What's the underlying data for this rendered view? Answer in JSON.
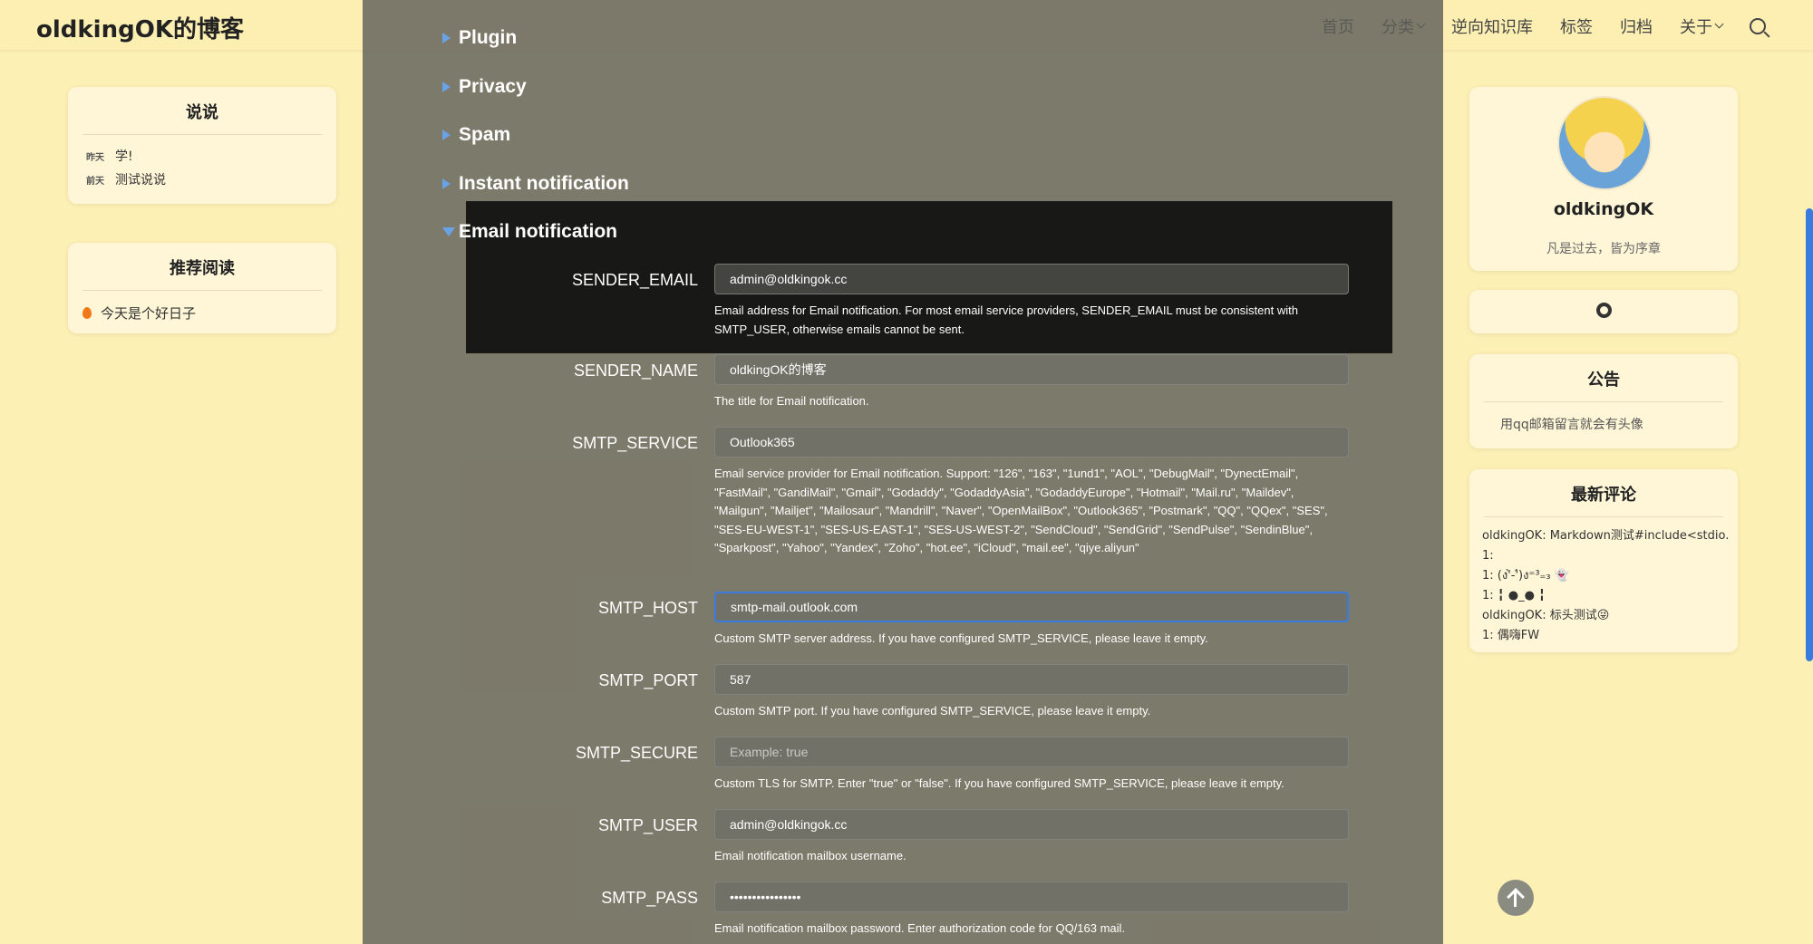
{
  "header": {
    "title": "oldkingOK的博客",
    "nav": [
      "首页",
      "分类",
      "逆向知识库",
      "标签",
      "归档",
      "关于"
    ]
  },
  "left": {
    "shuoshuo": {
      "title": "说说",
      "items": [
        {
          "date": "昨天",
          "text": "学!"
        },
        {
          "date": "前天",
          "text": "测试说说"
        }
      ]
    },
    "recommend": {
      "title": "推荐阅读",
      "items": [
        "今天是个好日子"
      ]
    }
  },
  "right": {
    "profile": {
      "name": "oldkingOK",
      "motto": "凡是过去，皆为序章"
    },
    "notice": {
      "title": "公告",
      "text": "用qq邮箱留言就会有头像"
    },
    "comments": {
      "title": "最新评论",
      "lines": [
        "oldkingOK: Markdown测试#include<stdio.",
        "1:",
        "1: (ง'̀-'́)ง⁼³₌₃ 👻",
        "1: ╏ ●_● ╏",
        "oldkingOK: 标头测试😜",
        "1: 偶嗨FW"
      ]
    }
  },
  "panel": {
    "sections": [
      {
        "label": "Plugin",
        "expanded": false
      },
      {
        "label": "Privacy",
        "expanded": false
      },
      {
        "label": "Spam",
        "expanded": false
      },
      {
        "label": "Instant notification",
        "expanded": false
      },
      {
        "label": "Email notification",
        "expanded": true
      }
    ],
    "fields": [
      {
        "label": "SENDER_EMAIL",
        "value": "admin@oldkingok.cc",
        "placeholder": "",
        "help": "Email address for Email notification. For most email service providers, SENDER_EMAIL must be consistent with SMTP_USER, otherwise emails cannot be sent."
      },
      {
        "label": "SENDER_NAME",
        "value": "oldkingOK的博客",
        "placeholder": "",
        "help": "The title for Email notification."
      },
      {
        "label": "SMTP_SERVICE",
        "value": "Outlook365",
        "placeholder": "",
        "help": "Email service provider for Email notification. Support: \"126\", \"163\", \"1und1\", \"AOL\", \"DebugMail\", \"DynectEmail\", \"FastMail\", \"GandiMail\", \"Gmail\", \"Godaddy\", \"GodaddyAsia\", \"GodaddyEurope\", \"Hotmail\", \"Mail.ru\", \"Maildev\", \"Mailgun\", \"Mailjet\", \"Mailosaur\", \"Mandrill\", \"Naver\", \"OpenMailBox\", \"Outlook365\", \"Postmark\", \"QQ\", \"QQex\", \"SES\", \"SES-EU-WEST-1\", \"SES-US-EAST-1\", \"SES-US-WEST-2\", \"SendCloud\", \"SendGrid\", \"SendPulse\", \"SendinBlue\", \"Sparkpost\", \"Yahoo\", \"Yandex\", \"Zoho\", \"hot.ee\", \"iCloud\", \"mail.ee\", \"qiye.aliyun\""
      },
      {
        "label": "SMTP_HOST",
        "value": "smtp-mail.outlook.com",
        "placeholder": "",
        "help": "Custom SMTP server address. If you have configured SMTP_SERVICE, please leave it empty."
      },
      {
        "label": "SMTP_PORT",
        "value": "587",
        "placeholder": "",
        "help": "Custom SMTP port. If you have configured SMTP_SERVICE, please leave it empty."
      },
      {
        "label": "SMTP_SECURE",
        "value": "",
        "placeholder": "Example: true",
        "help": "Custom TLS for SMTP. Enter \"true\" or \"false\". If you have configured SMTP_SERVICE, please leave it empty."
      },
      {
        "label": "SMTP_USER",
        "value": "admin@oldkingok.cc",
        "placeholder": "",
        "help": "Email notification mailbox username."
      },
      {
        "label": "SMTP_PASS",
        "value": "••••••••••••••••",
        "placeholder": "",
        "help": "Email notification mailbox password. Enter authorization code for QQ/163 mail."
      }
    ]
  },
  "colors": {
    "background": "#fdf0b4",
    "card": "#fff6d8",
    "accent": "#3a7be0",
    "triangle": "#6aa2e8"
  }
}
